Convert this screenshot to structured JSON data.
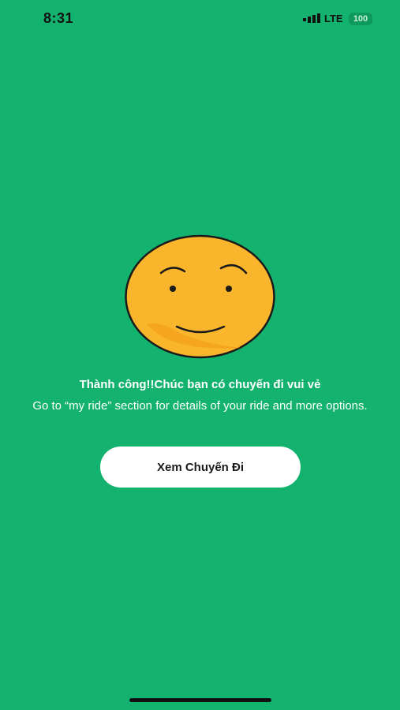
{
  "status_bar": {
    "time": "8:31",
    "network": "LTE",
    "battery": "100"
  },
  "icons": {
    "signal": "signal-bars-icon",
    "battery": "battery-icon",
    "illustration": "smiley-face-illustration"
  },
  "success": {
    "title": "Thành công!!Chúc bạn có chuyến đi vui vẻ",
    "subtitle": "Go to “my ride” section for details of your ride and more options.",
    "button_label": "Xem Chuyến Đi"
  },
  "colors": {
    "background": "#13b36f",
    "button": "#ffffff",
    "face": "#f9b52b"
  }
}
